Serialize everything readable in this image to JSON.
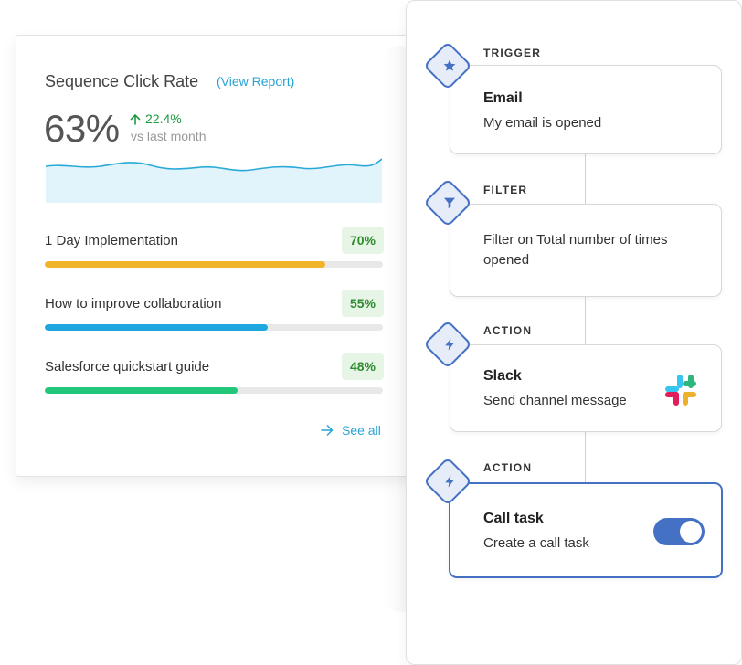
{
  "stats_card": {
    "title": "Sequence Click Rate",
    "report_link": "(View Report)",
    "rate": "63%",
    "change_value": "22.4%",
    "change_caption": "vs last month",
    "items": [
      {
        "label": "1 Day Implementation",
        "percent_label": "70%",
        "progress": 0.83,
        "color": "#f0b429"
      },
      {
        "label": "How to improve collaboration",
        "percent_label": "55%",
        "progress": 0.66,
        "color": "#1ea7de"
      },
      {
        "label": "Salesforce quickstart guide",
        "percent_label": "48%",
        "progress": 0.57,
        "color": "#22c77a"
      }
    ],
    "see_all": "See all"
  },
  "workflow": {
    "steps": [
      {
        "kicker": "TRIGGER",
        "title": "Email",
        "subtitle": "My email is opened",
        "icon": "star-icon"
      },
      {
        "kicker": "FILTER",
        "title": "",
        "subtitle": "Filter on Total number of times opened",
        "icon": "funnel-icon"
      },
      {
        "kicker": "ACTION",
        "title": "Slack",
        "subtitle": "Send channel message",
        "icon": "lightning-icon",
        "app_icon": "slack-logo-icon"
      },
      {
        "kicker": "ACTION",
        "title": "Call task",
        "subtitle": "Create a call task",
        "icon": "lightning-icon",
        "toggle_on": true
      }
    ]
  },
  "colors": {
    "accent": "#4471c4",
    "link": "#27a3d6",
    "positive": "#1c9b3f"
  }
}
